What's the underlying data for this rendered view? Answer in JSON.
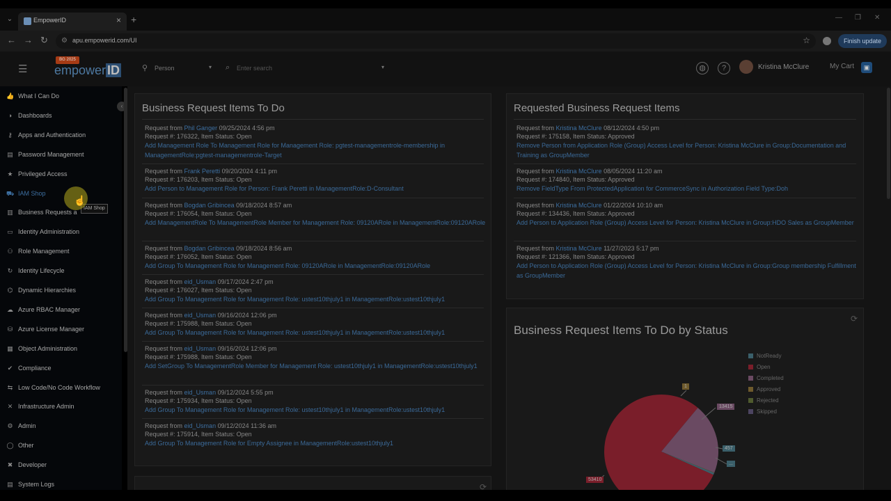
{
  "browser": {
    "tab_title": "EmpowerID",
    "url": "apu.empowerid.com/UI",
    "finish_update": "Finish update"
  },
  "header": {
    "logo_badge": "BG 2025",
    "logo_text_pre": "empower",
    "logo_text_id": "ID",
    "search_type": "Person",
    "search_placeholder": "Enter search",
    "user_name": "Kristina McClure",
    "my_cart": "My Cart"
  },
  "sidebar": {
    "items": [
      {
        "label": "What I Can Do",
        "icon": "thumbs-up-icon"
      },
      {
        "label": "Dashboards",
        "icon": "dashboard-icon"
      },
      {
        "label": "Apps and Authentication",
        "icon": "key-icon"
      },
      {
        "label": "Password Management",
        "icon": "password-icon"
      },
      {
        "label": "Privileged Access",
        "icon": "star-icon"
      },
      {
        "label": "IAM Shop",
        "icon": "cart-icon"
      },
      {
        "label": "Business Requests a",
        "icon": "document-icon"
      },
      {
        "label": "Identity Administration",
        "icon": "id-card-icon"
      },
      {
        "label": "Role Management",
        "icon": "roles-icon"
      },
      {
        "label": "Identity Lifecycle",
        "icon": "lifecycle-icon"
      },
      {
        "label": "Dynamic Hierarchies",
        "icon": "hierarchy-icon"
      },
      {
        "label": "Azure RBAC Manager",
        "icon": "azure-icon"
      },
      {
        "label": "Azure License Manager",
        "icon": "license-icon"
      },
      {
        "label": "Object Administration",
        "icon": "object-icon"
      },
      {
        "label": "Compliance",
        "icon": "compliance-icon"
      },
      {
        "label": "Low Code/No Code Workflow",
        "icon": "workflow-icon"
      },
      {
        "label": "Infrastructure Admin",
        "icon": "infrastructure-icon"
      },
      {
        "label": "Admin",
        "icon": "admin-icon"
      },
      {
        "label": "Other",
        "icon": "other-icon"
      },
      {
        "label": "Developer",
        "icon": "developer-icon"
      },
      {
        "label": "System Logs",
        "icon": "logs-icon"
      }
    ],
    "tooltip": "IAM Shop"
  },
  "todo": {
    "title": "Business Request Items To Do",
    "items": [
      {
        "from_label": "Request from",
        "who": "Phil Ganger",
        "date": "09/25/2024 4:56 pm",
        "meta": "Request #: 176322, Item Status: Open",
        "link": "Add Management Role To Management Role for Management Role: pgtest-managementrole-membership in ManagementRole:pgtest-managementrole-Target"
      },
      {
        "from_label": "Request from",
        "who": "Frank Peretti",
        "date": "09/20/2024 4:11 pm",
        "meta": "Request #: 176203, Item Status: Open",
        "link": "Add Person to Management Role for Person: Frank Peretti in ManagementRole:D-Consultant"
      },
      {
        "from_label": "Request from",
        "who": "Bogdan Gribincea",
        "date": "09/18/2024 8:57 am",
        "meta": "Request #: 176054, Item Status: Open",
        "link": "Add ManagementRole To ManagementRole Member for Management Role: 09120ARole in ManagementRole:09120ARole"
      },
      {
        "from_label": "Request from",
        "who": "Bogdan Gribincea",
        "date": "09/18/2024 8:56 am",
        "meta": "Request #: 176052, Item Status: Open",
        "link": "Add Group To Management Role for Management Role: 09120ARole in ManagementRole:09120ARole"
      },
      {
        "from_label": "Request from",
        "who": "eid_Usman",
        "date": "09/17/2024 2:47 pm",
        "meta": "Request #: 176027, Item Status: Open",
        "link": "Add Group To Management Role for Management Role: ustest10thjuly1 in ManagementRole:ustest10thjuly1"
      },
      {
        "from_label": "Request from",
        "who": "eid_Usman",
        "date": "09/16/2024 12:06 pm",
        "meta": "Request #: 175988, Item Status: Open",
        "link": "Add Group To Management Role for Management Role: ustest10thjuly1 in ManagementRole:ustest10thjuly1"
      },
      {
        "from_label": "Request from",
        "who": "eid_Usman",
        "date": "09/16/2024 12:06 pm",
        "meta": "Request #: 175988, Item Status: Open",
        "link": "Add SetGroup To ManagementRole Member for Management Role: ustest10thjuly1 in ManagementRole:ustest10thjuly1"
      },
      {
        "from_label": "Request from",
        "who": "eid_Usman",
        "date": "09/12/2024 5:55 pm",
        "meta": "Request #: 175934, Item Status: Open",
        "link": "Add Group To Management Role for Management Role: ustest10thjuly1 in ManagementRole:ustest10thjuly1"
      },
      {
        "from_label": "Request from",
        "who": "eid_Usman",
        "date": "09/12/2024 11:36 am",
        "meta": "Request #: 175914, Item Status: Open",
        "link": "Add Group To Management Role for Empty Assignee in ManagementRole:ustest10thjuly1"
      }
    ]
  },
  "requested": {
    "title": "Requested Business Request Items",
    "items": [
      {
        "from_label": "Request from",
        "who": "Kristina McClure",
        "date": "08/12/2024 4:50 pm",
        "meta": "Request #: 175158, Item Status: Approved",
        "link": "Remove Person from Application Role (Group) Access Level for Person: Kristina McClure in Group:Documentation and Training as GroupMember"
      },
      {
        "from_label": "Request from",
        "who": "Kristina McClure",
        "date": "08/05/2024 11:20 am",
        "meta": "Request #: 174840, Item Status: Approved",
        "link": "Remove FieldType From ProtectedApplication for CommerceSync in Authorization Field Type:Doh"
      },
      {
        "from_label": "Request from",
        "who": "Kristina McClure",
        "date": "01/22/2024 10:10 am",
        "meta": "Request #: 134436, Item Status: Approved",
        "link": "Add Person to Application Role (Group) Access Level for Person: Kristina McClure in Group:HDO Sales as GroupMember"
      },
      {
        "from_label": "Request from",
        "who": "Kristina McClure",
        "date": "11/27/2023 5:17 pm",
        "meta": "Request #: 121366, Item Status: Approved",
        "link": "Add Person to Application Role (Group) Access Level for Person: Kristina McClure in Group:Group membership Fulfillment as GroupMember"
      }
    ]
  },
  "status_chart": {
    "title": "Business Request Items To Do by Status",
    "legend": [
      {
        "label": "NotReady",
        "color": "#3a5f6a"
      },
      {
        "label": "Open",
        "color": "#7a1e2a"
      },
      {
        "label": "Completed",
        "color": "#6a4a62"
      },
      {
        "label": "Approved",
        "color": "#6e5a2c"
      },
      {
        "label": "Rejected",
        "color": "#4f5a2e"
      },
      {
        "label": "Skipped",
        "color": "#4c4460"
      }
    ]
  },
  "chart_data": {
    "type": "pie",
    "title": "Business Request Items To Do by Status",
    "slices": [
      {
        "name": "NotReady",
        "value": 457,
        "color": "#3a5f6a"
      },
      {
        "name": "Open",
        "value": 53410,
        "color": "#7a1e2a"
      },
      {
        "name": "Completed",
        "value": 13415,
        "color": "#6a4a62"
      },
      {
        "name": "Approved",
        "value": 1,
        "color": "#6e5a2c"
      },
      {
        "name": "Rejected",
        "value": 5,
        "color": "#4f5a2e"
      },
      {
        "name": "Skipped",
        "value": 2,
        "color": "#4c4460"
      }
    ],
    "labels": {
      "open": "53410",
      "completed": "13415",
      "notready": "457",
      "approved": "1",
      "small_right": "..."
    }
  }
}
